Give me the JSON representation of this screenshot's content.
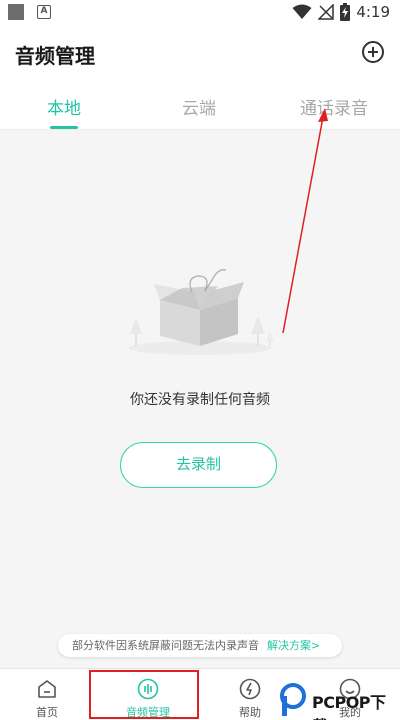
{
  "status_bar": {
    "time": "4:19",
    "notif_letter": "A"
  },
  "header": {
    "title": "音频管理",
    "add_icon": "plus-circle-icon"
  },
  "tabs": [
    {
      "label": "本地",
      "active": true
    },
    {
      "label": "云端",
      "active": false
    },
    {
      "label": "通话录音",
      "active": false
    }
  ],
  "empty_state": {
    "message": "你还没有录制任何音频",
    "button_label": "去录制",
    "illustration": "empty-box-illustration"
  },
  "notice": {
    "text": "部分软件因系统屏蔽问题无法内录声音",
    "link": "解决方案>"
  },
  "bottom_nav": [
    {
      "label": "首页",
      "icon": "home-icon",
      "active": false
    },
    {
      "label": "音频管理",
      "icon": "audio-wave-icon",
      "active": true
    },
    {
      "label": "帮助",
      "icon": "help-icon",
      "active": false
    },
    {
      "label": "我的",
      "icon": "profile-icon",
      "active": false
    }
  ],
  "watermark": {
    "text": "PCPOP下载"
  },
  "colors": {
    "accent": "#23c3a5",
    "annotation": "#e02020",
    "background": "#f5f5f5"
  }
}
